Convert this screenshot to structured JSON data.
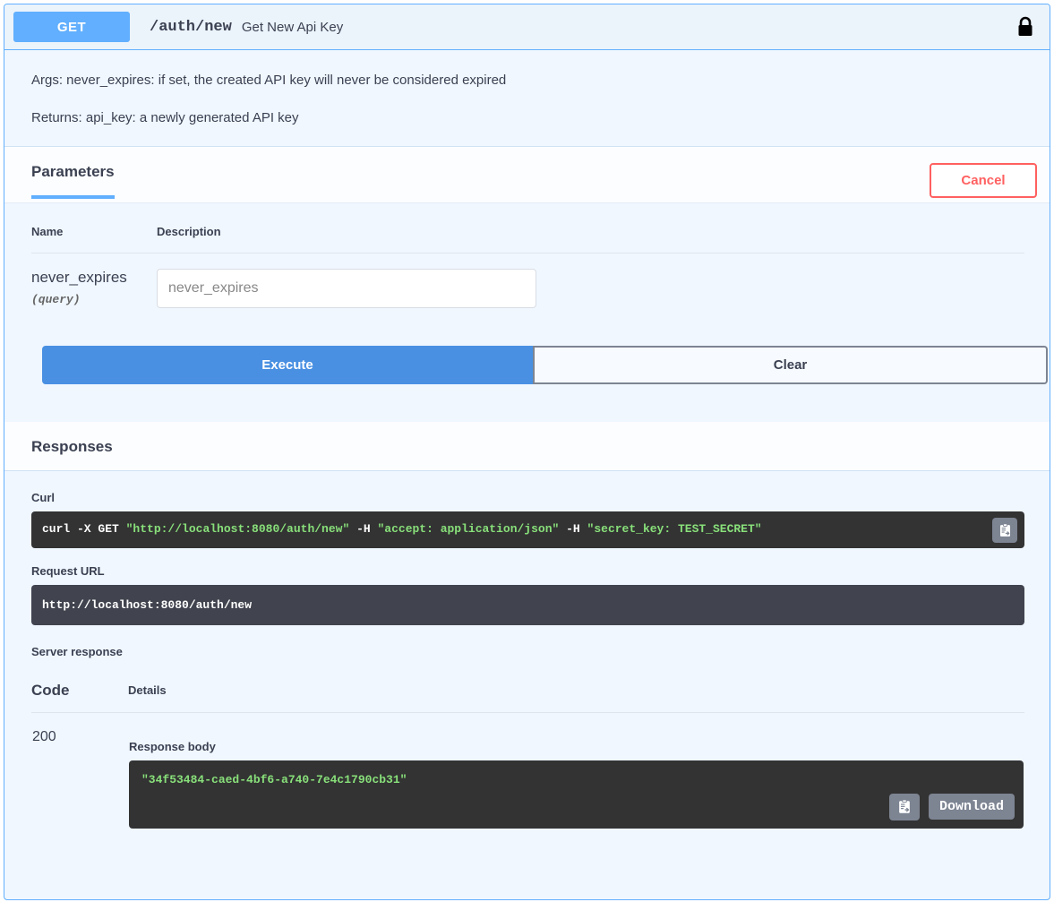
{
  "operation": {
    "method": "GET",
    "path": "/auth/new",
    "summary": "Get New Api Key",
    "auth_icon": "lock-icon",
    "description_lines": [
      "Args: never_expires: if set, the created API key will never be considered expired",
      "Returns: api_key: a newly generated API key"
    ]
  },
  "parameters_section": {
    "title": "Parameters",
    "cancel_label": "Cancel",
    "columns": {
      "name": "Name",
      "description": "Description"
    },
    "rows": [
      {
        "name": "never_expires",
        "in": "(query)",
        "input_value": "",
        "input_placeholder": "never_expires"
      }
    ],
    "execute_label": "Execute",
    "clear_label": "Clear"
  },
  "responses_section": {
    "title": "Responses",
    "curl_label": "Curl",
    "curl": {
      "prefix": "curl -X GET ",
      "url_arg": "\"http://localhost:8080/auth/new\"",
      "mid1": " -H  ",
      "accept_arg": "\"accept: application/json\"",
      "mid2": " -H  ",
      "secret_arg": "\"secret_key: TEST_SECRET\""
    },
    "copy_icon": "clipboard-copy-icon",
    "request_url_label": "Request URL",
    "request_url": "http://localhost:8080/auth/new",
    "server_response_label": "Server response",
    "columns": {
      "code": "Code",
      "details": "Details"
    },
    "rows": [
      {
        "code": "200",
        "response_body_label": "Response body",
        "response_body": "\"34f53484-caed-4bf6-a740-7e4c1790cb31\"",
        "copy_icon": "clipboard-copy-icon",
        "download_label": "Download"
      }
    ]
  },
  "colors": {
    "get_badge": "#61affe",
    "execute": "#4990e2",
    "cancel": "#ff6060",
    "code_bg": "#333333",
    "url_bg": "#41444e",
    "code_string": "#88e07a",
    "button_gray": "#7d8492"
  }
}
